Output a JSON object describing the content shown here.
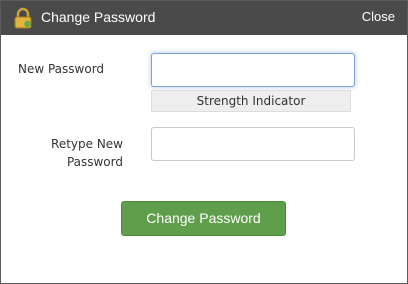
{
  "dialog": {
    "title": "Change Password",
    "close_label": "Close",
    "title_icon": "lock-icon"
  },
  "form": {
    "new_password_label": "New Password",
    "new_password_value": "",
    "strength_indicator": "Strength Indicator",
    "retype_label": "Retype New Password",
    "retype_value": "",
    "submit_label": "Change Password"
  },
  "colors": {
    "titlebar": "#4a4a4a",
    "submit_button": "#5f9e4b",
    "focus_border": "#7da2d6"
  }
}
